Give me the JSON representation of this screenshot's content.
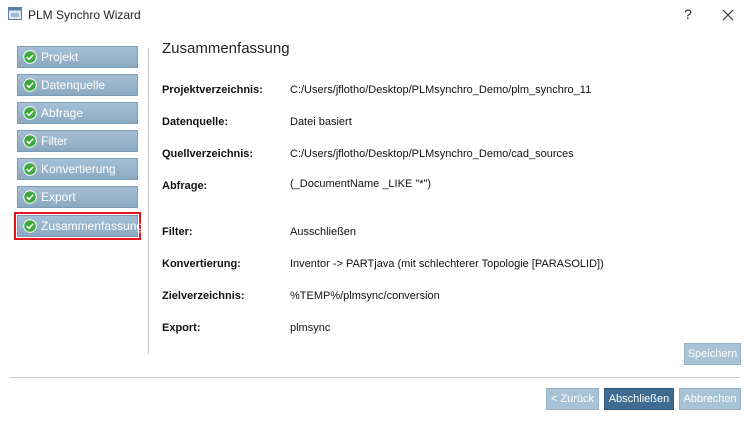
{
  "window": {
    "title": "PLM Synchro Wizard",
    "help_label": "?"
  },
  "sidebar": {
    "items": [
      {
        "label": "Projekt",
        "state": "done"
      },
      {
        "label": "Datenquelle",
        "state": "done"
      },
      {
        "label": "Abfrage",
        "state": "done"
      },
      {
        "label": "Filter",
        "state": "done"
      },
      {
        "label": "Konvertierung",
        "state": "done"
      },
      {
        "label": "Export",
        "state": "done"
      },
      {
        "label": "Zusammenfassung",
        "state": "active"
      }
    ]
  },
  "summary": {
    "heading": "Zusammenfassung",
    "rows": [
      {
        "label": "Projektverzeichnis:",
        "value": "C:/Users/jflotho/Desktop/PLMsynchro_Demo/plm_synchro_11"
      },
      {
        "label": "Datenquelle:",
        "value": "Datei basiert"
      },
      {
        "label": "Quellverzeichnis:",
        "value": "C:/Users/jflotho/Desktop/PLMsynchro_Demo/cad_sources"
      },
      {
        "label": "Abfrage:",
        "value": "(_DocumentName _LIKE \"*\")"
      },
      {
        "label": "Filter:",
        "value": "Ausschließen"
      },
      {
        "label": "Konvertierung:",
        "value": "Inventor -> PARTjava (mit schlechterer Topologie [PARASOLID])"
      },
      {
        "label": "Zielverzeichnis:",
        "value": "%TEMP%/plmsync/conversion"
      },
      {
        "label": "Export:",
        "value": "plmsync"
      }
    ]
  },
  "buttons": {
    "save": "Speichern",
    "back": "< Zurück",
    "finish": "Abschließen",
    "cancel": "Abbrechen"
  },
  "colors": {
    "step_bg": "#8aa9c2",
    "check_green": "#3ea83e",
    "active_outline": "#e3161d",
    "primary_button": "#3e6b8f",
    "disabled_button": "#a8c2d6"
  }
}
